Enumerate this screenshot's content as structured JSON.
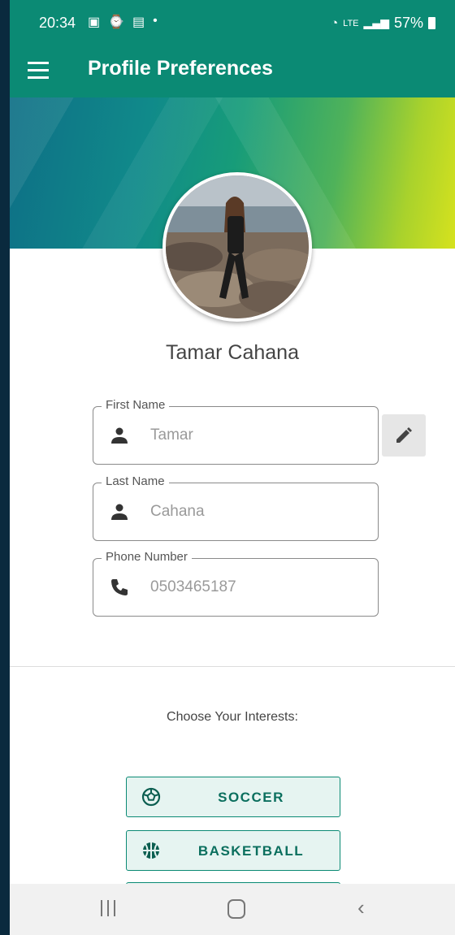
{
  "status_bar": {
    "time": "20:34",
    "battery": "57%",
    "network": "LTE"
  },
  "app_bar": {
    "title": "Profile Preferences"
  },
  "profile": {
    "name": "Tamar Cahana"
  },
  "fields": {
    "first_name": {
      "label": "First Name",
      "value": "Tamar",
      "icon": "person-icon"
    },
    "last_name": {
      "label": "Last Name",
      "value": "Cahana",
      "icon": "person-icon"
    },
    "phone": {
      "label": "Phone Number",
      "value": "0503465187",
      "icon": "phone-icon"
    }
  },
  "interests": {
    "title": "Choose Your Interests:",
    "items": [
      {
        "label": "SOCCER",
        "icon": "soccer-ball-icon"
      },
      {
        "label": "BASKETBALL",
        "icon": "basketball-icon"
      }
    ]
  },
  "colors": {
    "primary": "#0b8a74",
    "accent_yellow": "#d6e21e",
    "button_fill": "#e6f4f1"
  }
}
